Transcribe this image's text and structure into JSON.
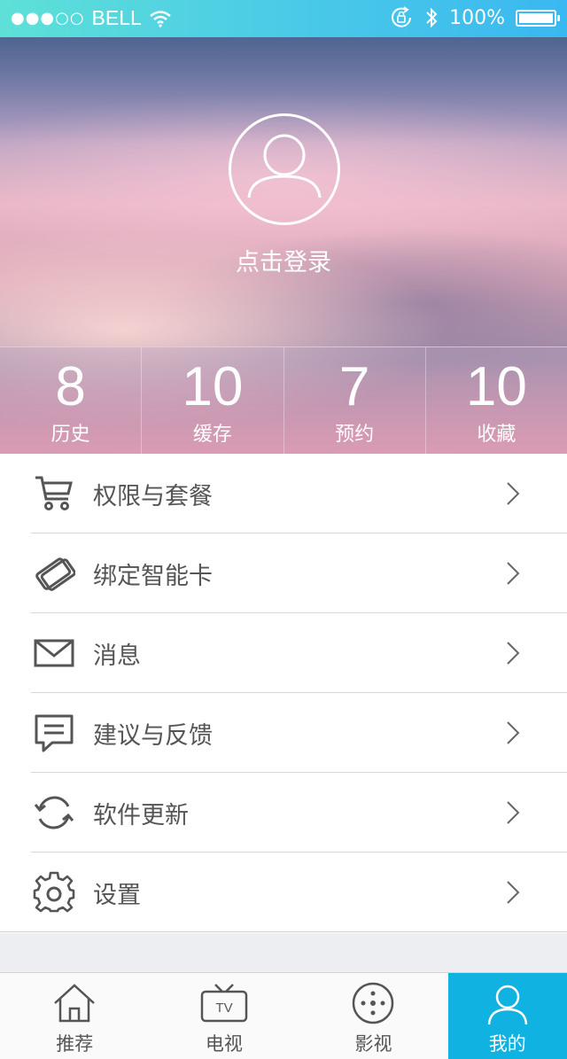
{
  "status_bar": {
    "signal": "●●●○○",
    "carrier": "BELL",
    "battery": "100%"
  },
  "profile": {
    "login_label": "点击登录"
  },
  "stats": [
    {
      "value": "8",
      "label": "历史"
    },
    {
      "value": "10",
      "label": "缓存"
    },
    {
      "value": "7",
      "label": "预约"
    },
    {
      "value": "10",
      "label": "收藏"
    }
  ],
  "menu": [
    {
      "label": "权限与套餐",
      "icon": "cart-icon"
    },
    {
      "label": "绑定智能卡",
      "icon": "smart-card-icon"
    },
    {
      "label": "消息",
      "icon": "envelope-icon"
    },
    {
      "label": "建议与反馈",
      "icon": "feedback-icon"
    },
    {
      "label": "软件更新",
      "icon": "refresh-icon"
    },
    {
      "label": "设置",
      "icon": "gear-icon"
    }
  ],
  "tabs": [
    {
      "label": "推荐",
      "icon": "home-icon"
    },
    {
      "label": "电视",
      "icon": "tv-icon"
    },
    {
      "label": "影视",
      "icon": "film-reel-icon"
    },
    {
      "label": "我的",
      "icon": "user-icon",
      "active": true
    }
  ],
  "colors": {
    "accent": "#0fb2e1",
    "status_bar": "#49c9e8",
    "text": "#555555"
  }
}
